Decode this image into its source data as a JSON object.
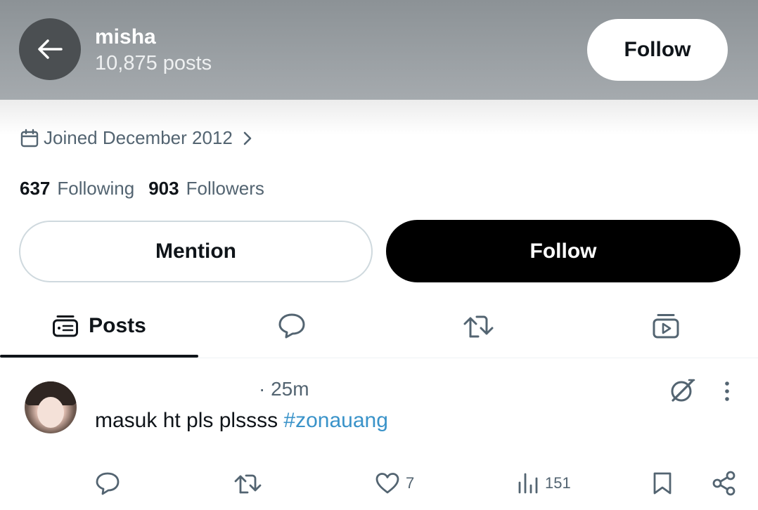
{
  "header": {
    "name": "misha",
    "posts_count": "10,875 posts",
    "follow_label": "Follow"
  },
  "profile": {
    "joined": "Joined December 2012",
    "following_count": "637",
    "following_label": "Following",
    "followers_count": "903",
    "followers_label": "Followers",
    "mention_label": "Mention",
    "follow_label": "Follow"
  },
  "tabs": {
    "posts_label": "Posts",
    "icons": [
      "posts-icon",
      "replies-icon",
      "reposts-icon",
      "media-icon"
    ]
  },
  "post": {
    "time": "· 25m",
    "text": "masuk ht pls plssss ",
    "hashtag": "#zonauang",
    "likes": "7",
    "views": "151"
  },
  "colors": {
    "header_bg": "#9aa0a4",
    "link": "#3a93c9",
    "muted": "#536471",
    "primary_button": "#000000"
  }
}
